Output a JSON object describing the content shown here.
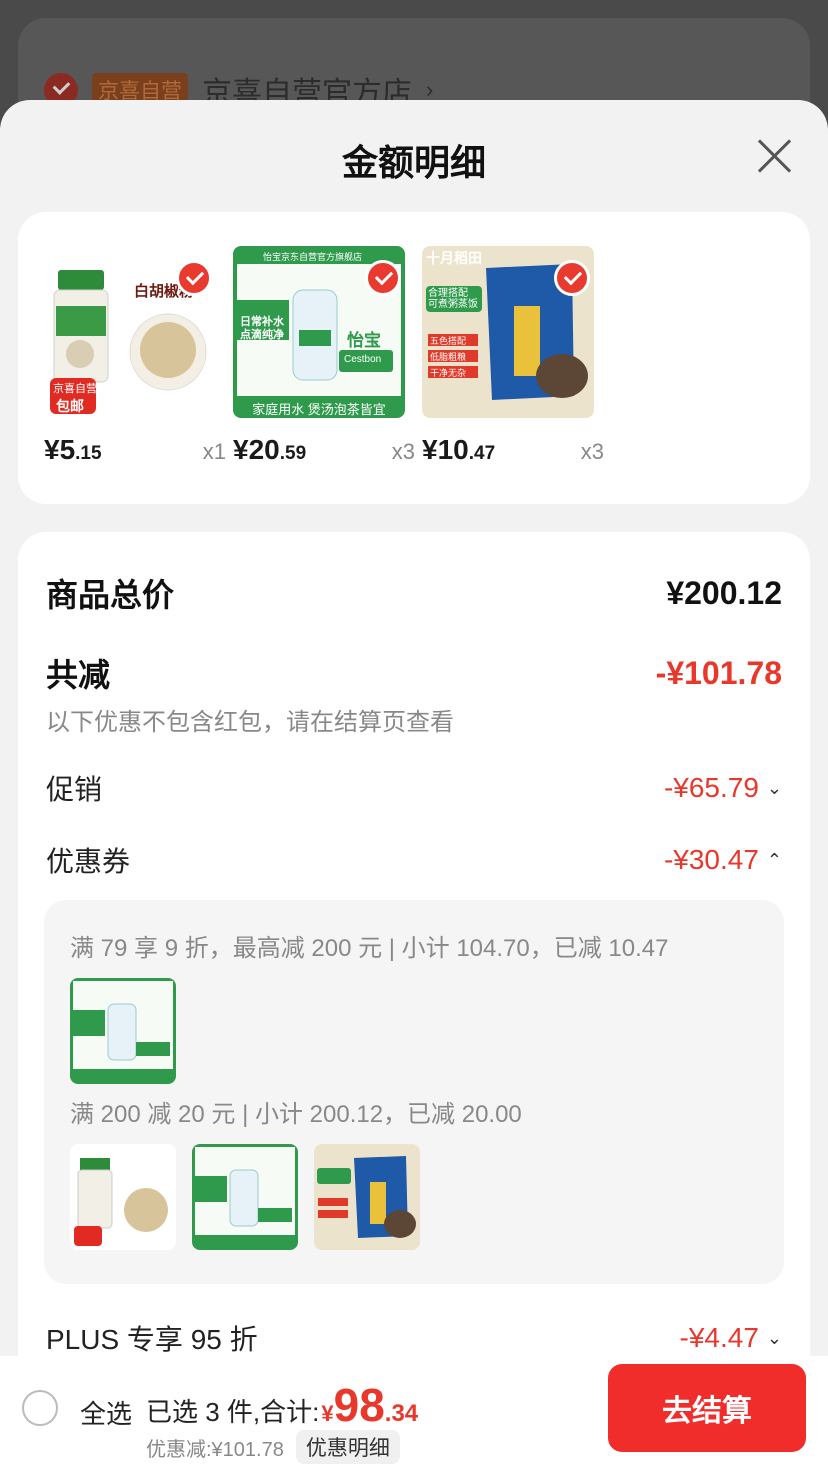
{
  "background": {
    "store_tag": "京喜自营",
    "store_name": "京喜自营官方店",
    "arrow": "›"
  },
  "sheet": {
    "title": "金额明细"
  },
  "products": [
    {
      "price_int": "¥5",
      "price_dec": ".15",
      "qty": "x1",
      "image_label": "白胡椒粉",
      "badge_top": "京喜自营",
      "badge_bottom": "包邮"
    },
    {
      "price_int": "¥20",
      "price_dec": ".59",
      "qty": "x3",
      "image_label": "日常补水 点滴纯净",
      "brand": "怡宝",
      "header_text": "怡宝京东自营官方旗舰店",
      "caption": "家庭用水 煲汤泡茶皆宜",
      "logo": "Cestbon"
    },
    {
      "price_int": "¥10",
      "price_dec": ".47",
      "qty": "x3",
      "brand": "十月稻田",
      "tag1": "合理搭配 可煮粥蒸饭",
      "tags": [
        "五色搭配",
        "低脂粗粮",
        "干净无杂"
      ]
    }
  ],
  "summary": {
    "total_label": "商品总价",
    "total_value": "¥200.12",
    "reduce_label": "共减",
    "reduce_value": "-¥101.78",
    "note": "以下优惠不包含红包，请在结算页查看",
    "promo_label": "促销",
    "promo_value": "-¥65.79",
    "coupon_label": "优惠券",
    "coupon_value": "-¥30.47",
    "coupon_lines": [
      "满 79 享 9 折，最高减 200 元 | 小计 104.70，已减 10.47",
      "满 200 减 20 元 | 小计 200.12，已减 20.00"
    ],
    "plus_label": "PLUS 专享 95 折",
    "plus_value": "-¥4.47"
  },
  "bottom": {
    "select_all": "全选",
    "selected_text": "已选 3 件,合计:",
    "total_yen": "¥",
    "total_int": "98",
    "total_dec": ".34",
    "discount_text": "优惠减:¥101.78",
    "detail_pill": "优惠明细",
    "checkout": "去结算"
  },
  "colors": {
    "accent": "#e8372b",
    "button": "#f12d2b"
  }
}
